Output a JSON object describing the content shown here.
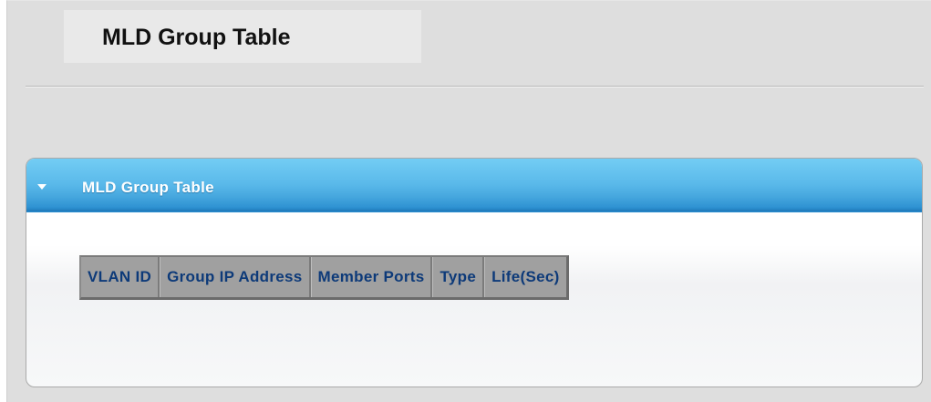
{
  "page": {
    "title": "MLD Group Table"
  },
  "panel": {
    "title": "MLD Group Table",
    "collapse_icon": "triangle-down-icon",
    "header_color": "#5ab9ea"
  },
  "table": {
    "columns": [
      "VLAN ID",
      "Group IP Address",
      "Member Ports",
      "Type",
      "Life(Sec)"
    ],
    "header_text_color": "#0d3a79",
    "rows": []
  }
}
